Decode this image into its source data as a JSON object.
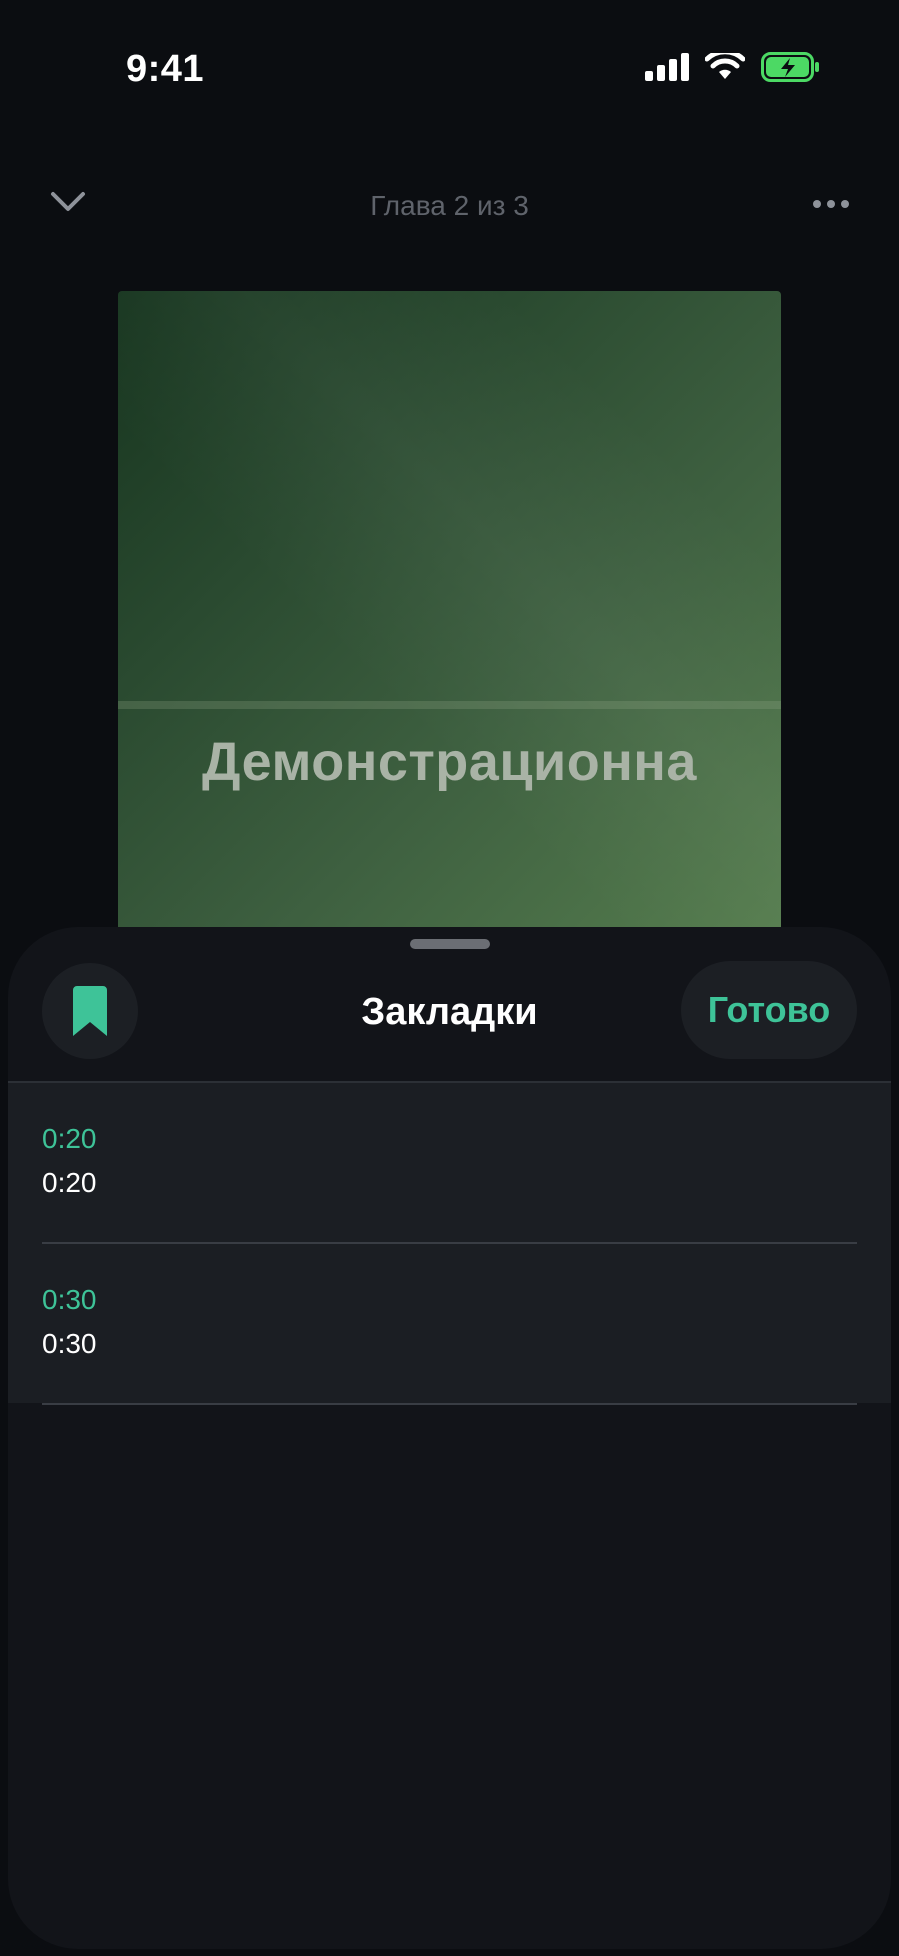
{
  "status_bar": {
    "time": "9:41"
  },
  "player": {
    "chapter": "Глава 2 из 3",
    "cover_title": "Демонстрационна"
  },
  "sheet": {
    "title": "Закладки",
    "done_label": "Готово",
    "bookmarks": [
      {
        "time": "0:20",
        "title": "0:20"
      },
      {
        "time": "0:30",
        "title": "0:30"
      }
    ]
  },
  "colors": {
    "accent": "#3ec398",
    "background": "#0b0d11",
    "sheet_background": "#121419",
    "battery": "#4cd964"
  },
  "icons": {
    "collapse": "chevron-down-icon",
    "more": "more-horizontal-icon",
    "bookmark": "bookmark-icon",
    "signal": "cellular-signal-icon",
    "wifi": "wifi-icon",
    "battery": "battery-charging-icon"
  }
}
